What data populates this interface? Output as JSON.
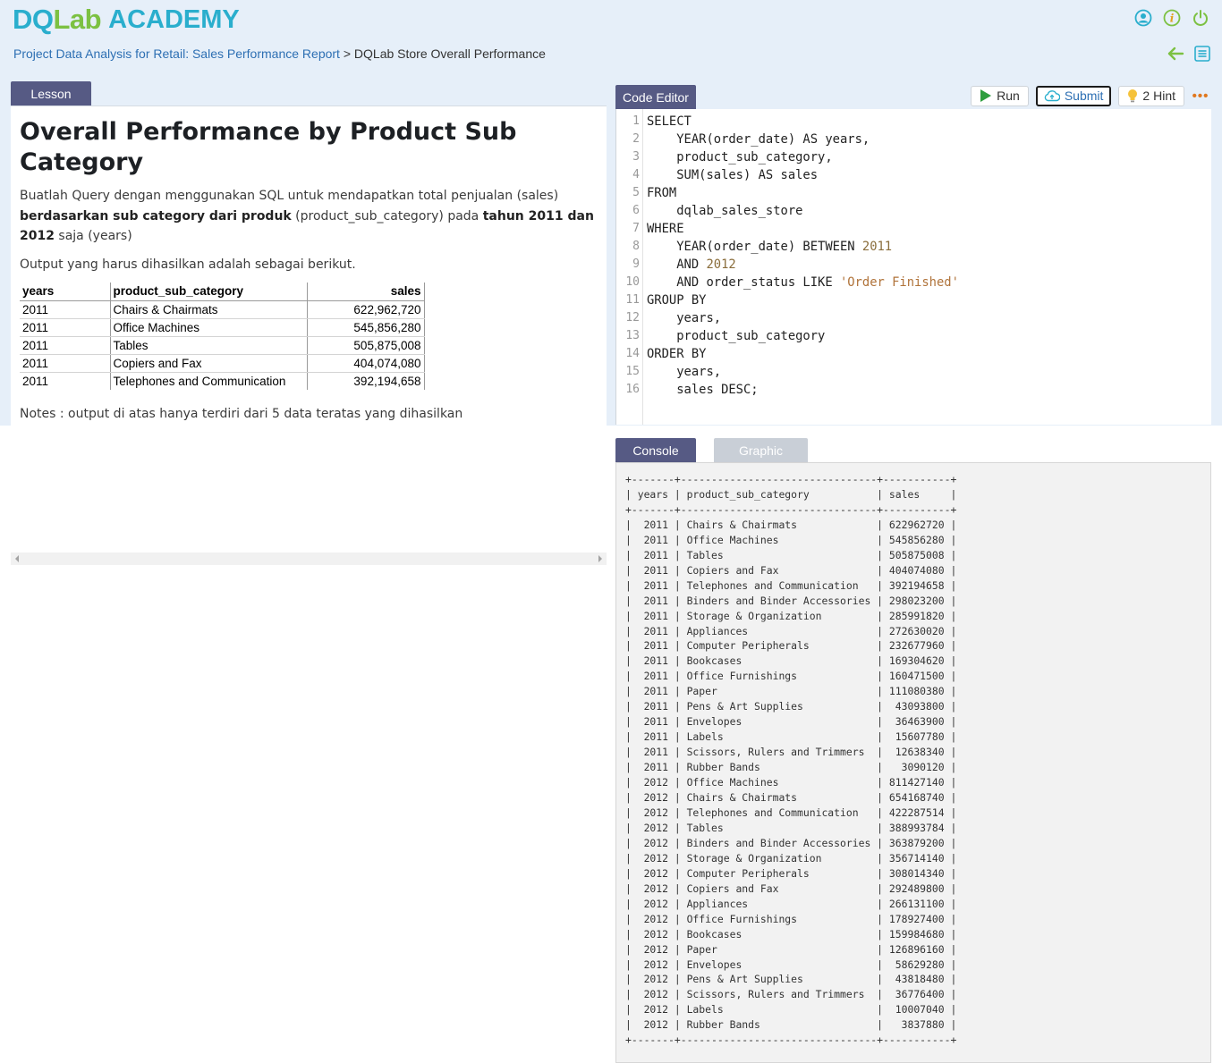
{
  "header": {
    "logo_main_1": "DQ",
    "logo_main_2": "Lab",
    "logo_sub": "ACADEMY",
    "breadcrumb_link": "Project Data Analysis for Retail: Sales Performance Report",
    "breadcrumb_sep": " > ",
    "breadcrumb_current": "DQLab Store Overall Performance",
    "icons": [
      "user-icon",
      "info-icon",
      "power-icon",
      "back-arrow-icon",
      "list-icon"
    ]
  },
  "colors": {
    "accent_tab": "#565a84",
    "brand_blue": "#2aaecd",
    "brand_green": "#7cc142",
    "header_bg": "#e6eff9"
  },
  "lesson": {
    "tab_label": "Lesson",
    "title": "Overall Performance by Product Sub Category",
    "p1_a": "Buatlah Query dengan menggunakan SQL untuk mendapatkan total penjualan (sales) ",
    "p1_b": "berdasarkan sub category dari produk",
    "p1_c": " (product_sub_category) pada ",
    "p1_d": "tahun 2011 dan 2012",
    "p1_e": " saja (years)",
    "p2": "Output yang harus dihasilkan adalah sebagai berikut.",
    "table": {
      "headers": [
        "years",
        "product_sub_category",
        "sales"
      ],
      "rows": [
        [
          "2011",
          "Chairs & Chairmats",
          "622,962,720"
        ],
        [
          "2011",
          "Office Machines",
          "545,856,280"
        ],
        [
          "2011",
          "Tables",
          "505,875,008"
        ],
        [
          "2011",
          "Copiers and Fax",
          "404,074,080"
        ],
        [
          "2011",
          "Telephones and Communication",
          "392,194,658"
        ]
      ]
    },
    "notes": "Notes : output di atas hanya terdiri dari 5 data teratas yang dihasilkan"
  },
  "editor": {
    "tab_label": "Code Editor",
    "run_label": "Run",
    "submit_label": "Submit",
    "hint_label": "2 Hint",
    "more_label": "•••",
    "code_lines": [
      "SELECT",
      "    YEAR(order_date) AS years,",
      "    product_sub_category,",
      "    SUM(sales) AS sales",
      "FROM",
      "    dqlab_sales_store",
      "WHERE",
      "    YEAR(order_date) BETWEEN 2011",
      "    AND 2012",
      "    AND order_status LIKE 'Order Finished'",
      "GROUP BY",
      "    years,",
      "    product_sub_category",
      "ORDER BY",
      "    years,",
      "    sales DESC;"
    ]
  },
  "console": {
    "tab_label": "Console",
    "graphic_tab_label": "Graphic",
    "headers": [
      "years",
      "product_sub_category",
      "sales"
    ],
    "rows": [
      [
        "2011",
        "Chairs & Chairmats",
        "622962720"
      ],
      [
        "2011",
        "Office Machines",
        "545856280"
      ],
      [
        "2011",
        "Tables",
        "505875008"
      ],
      [
        "2011",
        "Copiers and Fax",
        "404074080"
      ],
      [
        "2011",
        "Telephones and Communication",
        "392194658"
      ],
      [
        "2011",
        "Binders and Binder Accessories",
        "298023200"
      ],
      [
        "2011",
        "Storage & Organization",
        "285991820"
      ],
      [
        "2011",
        "Appliances",
        "272630020"
      ],
      [
        "2011",
        "Computer Peripherals",
        "232677960"
      ],
      [
        "2011",
        "Bookcases",
        "169304620"
      ],
      [
        "2011",
        "Office Furnishings",
        "160471500"
      ],
      [
        "2011",
        "Paper",
        "111080380"
      ],
      [
        "2011",
        "Pens & Art Supplies",
        "43093800"
      ],
      [
        "2011",
        "Envelopes",
        "36463900"
      ],
      [
        "2011",
        "Labels",
        "15607780"
      ],
      [
        "2011",
        "Scissors, Rulers and Trimmers",
        "12638340"
      ],
      [
        "2011",
        "Rubber Bands",
        "3090120"
      ],
      [
        "2012",
        "Office Machines",
        "811427140"
      ],
      [
        "2012",
        "Chairs & Chairmats",
        "654168740"
      ],
      [
        "2012",
        "Telephones and Communication",
        "422287514"
      ],
      [
        "2012",
        "Tables",
        "388993784"
      ],
      [
        "2012",
        "Binders and Binder Accessories",
        "363879200"
      ],
      [
        "2012",
        "Storage & Organization",
        "356714140"
      ],
      [
        "2012",
        "Computer Peripherals",
        "308014340"
      ],
      [
        "2012",
        "Copiers and Fax",
        "292489800"
      ],
      [
        "2012",
        "Appliances",
        "266131100"
      ],
      [
        "2012",
        "Office Furnishings",
        "178927400"
      ],
      [
        "2012",
        "Bookcases",
        "159984680"
      ],
      [
        "2012",
        "Paper",
        "126896160"
      ],
      [
        "2012",
        "Envelopes",
        "58629280"
      ],
      [
        "2012",
        "Pens & Art Supplies",
        "43818480"
      ],
      [
        "2012",
        "Scissors, Rulers and Trimmers",
        "36776400"
      ],
      [
        "2012",
        "Labels",
        "10007040"
      ],
      [
        "2012",
        "Rubber Bands",
        "3837880"
      ]
    ]
  }
}
